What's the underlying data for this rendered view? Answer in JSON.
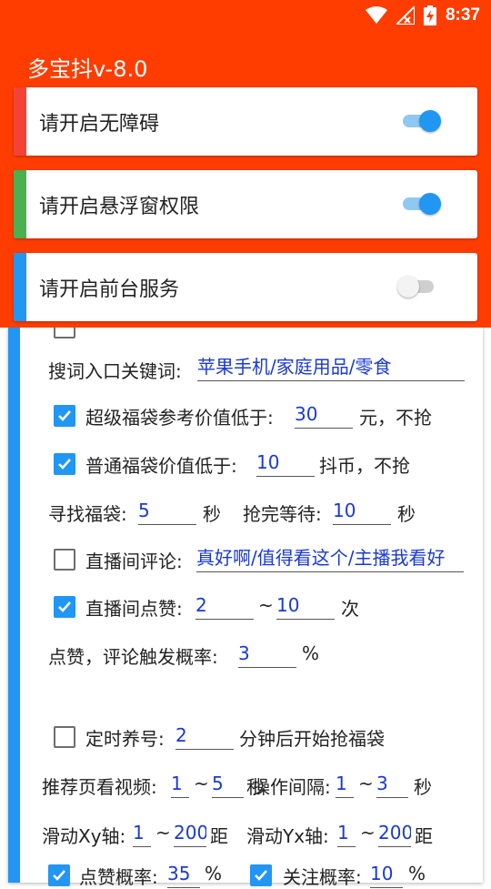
{
  "status_bar": {
    "time": "8:37"
  },
  "app": {
    "title": "多宝抖v-8.0"
  },
  "permissions": [
    {
      "label": "请开启无障碍",
      "enabled": true,
      "stripe_color": "#f44336"
    },
    {
      "label": "请开启悬浮窗权限",
      "enabled": true,
      "stripe_color": "#4caf50"
    },
    {
      "label": "请开启前台服务",
      "enabled": false,
      "stripe_color": "#2196f3"
    }
  ],
  "settings": {
    "keyword_label": "搜词入口关键词:",
    "keyword_value": "苹果手机/家庭用品/零食",
    "super_bag": {
      "checked": true,
      "label": "超级福袋参考价值低于:",
      "value": "30",
      "suffix": "元，不抢"
    },
    "normal_bag": {
      "checked": true,
      "label": "普通福袋价值低于:",
      "value": "10",
      "suffix": "抖币，不抢"
    },
    "find_bag_label": "寻找福袋:",
    "find_bag_value": "5",
    "find_bag_unit": "秒",
    "wait_label": "抢完等待:",
    "wait_value": "10",
    "wait_unit": "秒",
    "comment": {
      "checked": false,
      "label": "直播间评论:",
      "value": "真好啊/值得看这个/主播我看好"
    },
    "like": {
      "checked": true,
      "label": "直播间点赞:",
      "min": "2",
      "tilde": "~",
      "max": "10",
      "unit": "次"
    },
    "prob_label": "点赞，评论触发概率:",
    "prob_value": "3",
    "prob_unit": "%",
    "timer": {
      "checked": false,
      "label": "定时养号:",
      "value": "2",
      "suffix": "分钟后开始抢福袋"
    },
    "video_label": "推荐页看视频:",
    "video_min": "1",
    "video_max": "5",
    "interval_label": "操作间隔:",
    "interval_min": "1",
    "interval_max": "3",
    "interval_unit": "秒",
    "overlap_char": "秒",
    "slide_xy_label": "滑动Xy轴:",
    "slide_xy_min": "1",
    "slide_xy_max": "200",
    "slide_xy_unit": "距",
    "slide_yx_label": "滑动Yx轴:",
    "slide_yx_min": "1",
    "slide_yx_max": "200",
    "slide_yx_unit": "距",
    "like_prob_label": "点赞概率:",
    "like_prob_value": "35",
    "follow_prob_label": "关注概率:",
    "follow_prob_value": "10",
    "percent": "%",
    "tilde": "~"
  }
}
